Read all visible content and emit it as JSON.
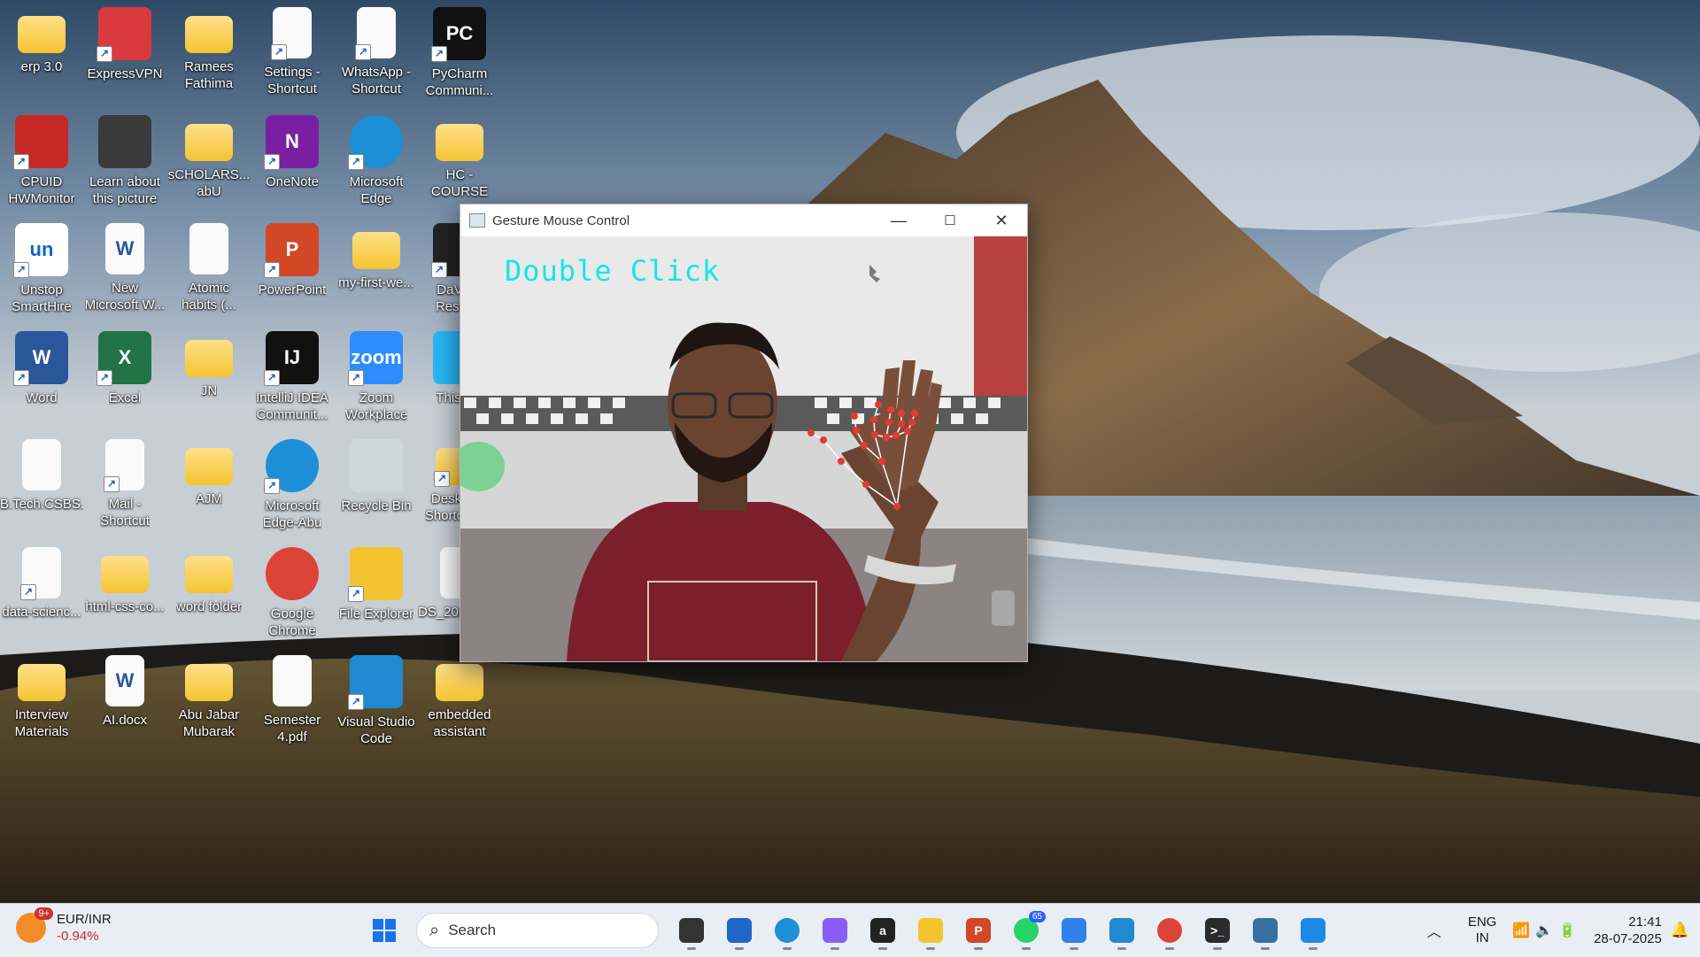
{
  "desktop_icons": [
    {
      "label": "erp 3.0",
      "icon": "folder-icon",
      "shortcut": false
    },
    {
      "label": "ExpressVPN",
      "icon": "expressvpn-icon",
      "shortcut": true
    },
    {
      "label": "Ramees\nFathima",
      "icon": "folder-icon",
      "shortcut": false
    },
    {
      "label": "Settings -\nShortcut",
      "icon": "document-icon",
      "shortcut": true
    },
    {
      "label": "WhatsApp -\nShortcut",
      "icon": "document-icon",
      "shortcut": true
    },
    {
      "label": "PyCharm\nCommuni...",
      "icon": "pycharm-icon",
      "shortcut": true
    },
    {
      "label": "CPUID\nHWMonitor",
      "icon": "hwmonitor-icon",
      "shortcut": true
    },
    {
      "label": "Learn about\nthis picture",
      "icon": "camera-icon",
      "shortcut": false
    },
    {
      "label": "sCHOLARS...\nabU",
      "icon": "folder-icon",
      "shortcut": false
    },
    {
      "label": "OneNote",
      "icon": "onenote-icon",
      "shortcut": true
    },
    {
      "label": "Microsoft\nEdge",
      "icon": "edge-icon",
      "shortcut": true
    },
    {
      "label": "HC - COURSE",
      "icon": "folder-icon",
      "shortcut": false
    },
    {
      "label": "Unstop\nSmartHire",
      "icon": "unstop-icon",
      "shortcut": true
    },
    {
      "label": "New\nMicrosoft W...",
      "icon": "word-doc-icon",
      "shortcut": false
    },
    {
      "label": "Atomic\nhabits (...",
      "icon": "pdf-icon",
      "shortcut": false
    },
    {
      "label": "PowerPoint",
      "icon": "powerpoint-icon",
      "shortcut": true
    },
    {
      "label": "my-first-we...",
      "icon": "folder-icon",
      "shortcut": false
    },
    {
      "label": "DaVinci\nResolve",
      "icon": "davinci-icon",
      "shortcut": true
    },
    {
      "label": "Word",
      "icon": "word-icon",
      "shortcut": true
    },
    {
      "label": "Excel",
      "icon": "excel-icon",
      "shortcut": true
    },
    {
      "label": "JN",
      "icon": "folder-icon",
      "shortcut": false
    },
    {
      "label": "IntelliJ IDEA\nCommunit...",
      "icon": "intellij-icon",
      "shortcut": true
    },
    {
      "label": "Zoom\nWorkplace",
      "icon": "zoom-icon",
      "shortcut": true
    },
    {
      "label": "This PC",
      "icon": "this-pc-icon",
      "shortcut": false
    },
    {
      "label": "B.Tech.CSBS....",
      "icon": "pdf-icon",
      "shortcut": false
    },
    {
      "label": "Mail -\nShortcut",
      "icon": "document-icon",
      "shortcut": true
    },
    {
      "label": "AJM",
      "icon": "folder-icon",
      "shortcut": false
    },
    {
      "label": "Microsoft\nEdge-Abu",
      "icon": "edge-icon",
      "shortcut": true
    },
    {
      "label": "Recycle Bin",
      "icon": "recycle-bin-icon",
      "shortcut": false
    },
    {
      "label": "Desktop -\nShortcut (2)",
      "icon": "folder-icon",
      "shortcut": true
    },
    {
      "label": "data-scienc...",
      "icon": "pdf-icon",
      "shortcut": true
    },
    {
      "label": "html-css-co...",
      "icon": "folder-icon",
      "shortcut": false
    },
    {
      "label": "word folder",
      "icon": "folder-icon",
      "shortcut": false
    },
    {
      "label": "Google\nChrome",
      "icon": "chrome-icon",
      "shortcut": false
    },
    {
      "label": "File Explorer",
      "icon": "file-explorer-icon",
      "shortcut": true
    },
    {
      "label": "DS_2024_R...",
      "icon": "pdf-icon",
      "shortcut": false
    },
    {
      "label": "Interview\nMaterials",
      "icon": "folder-icon",
      "shortcut": false
    },
    {
      "label": "AI.docx",
      "icon": "word-doc-icon",
      "shortcut": false
    },
    {
      "label": "Abu Jabar\nMubarak",
      "icon": "folder-icon",
      "shortcut": false
    },
    {
      "label": "Semester\n4.pdf",
      "icon": "pdf-icon",
      "shortcut": false
    },
    {
      "label": "Visual Studio\nCode",
      "icon": "vscode-icon",
      "shortcut": true
    },
    {
      "label": "embedded\nassistant",
      "icon": "folder-icon",
      "shortcut": false
    }
  ],
  "window": {
    "title": "Gesture Mouse Control",
    "minimize_symbol": "—",
    "maximize_symbol": "☐",
    "close_symbol": "✕",
    "gesture_text": "Double Click"
  },
  "taskbar": {
    "widget": {
      "badge": "9+",
      "pair": "EUR/INR",
      "change": "-0.94%"
    },
    "search_placeholder": "Search",
    "apps": [
      {
        "name": "task-view",
        "label": "",
        "color": "#333333"
      },
      {
        "name": "microsoft-store",
        "label": "",
        "color": "#1e66c8"
      },
      {
        "name": "edge",
        "label": "",
        "color": "#1c8fd6"
      },
      {
        "name": "copilot",
        "label": "",
        "color": "#8a5cf6"
      },
      {
        "name": "amazon",
        "label": "a",
        "color": "#222222"
      },
      {
        "name": "file-explorer",
        "label": "",
        "color": "#f4c430"
      },
      {
        "name": "powerpoint",
        "label": "P",
        "color": "#d24726"
      },
      {
        "name": "whatsapp",
        "label": "",
        "color": "#25d366",
        "badge": "65"
      },
      {
        "name": "notes",
        "label": "",
        "color": "#2f80ed"
      },
      {
        "name": "vscode",
        "label": "",
        "color": "#1f8ad2"
      },
      {
        "name": "chrome",
        "label": "",
        "color": "#db4437"
      },
      {
        "name": "terminal",
        "label": ">_",
        "color": "#2b2b2b"
      },
      {
        "name": "python-idle",
        "label": "",
        "color": "#3670a0"
      },
      {
        "name": "photos",
        "label": "",
        "color": "#1e88e5"
      }
    ],
    "tray": {
      "lang1": "ENG",
      "lang2": "IN",
      "time": "21:41",
      "date": "28-07-2025"
    }
  }
}
